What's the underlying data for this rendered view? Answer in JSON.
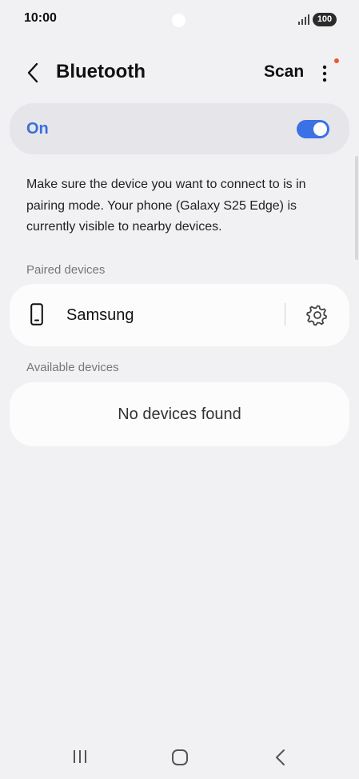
{
  "status_bar": {
    "time": "10:00",
    "battery": "100",
    "signal_icon": "signal-bars-icon"
  },
  "header": {
    "title": "Bluetooth",
    "scan_label": "Scan",
    "back_icon": "chevron-left-icon",
    "more_icon": "more-vertical-icon",
    "notification_dot_color": "#f0562c"
  },
  "toggle": {
    "label": "On",
    "state": true,
    "accent_color": "#3b71e5"
  },
  "info": {
    "text": "Make sure the device you want to connect to is in pairing mode. Your phone (Galaxy S25 Edge) is currently visible to nearby devices."
  },
  "paired": {
    "header": "Paired devices",
    "devices": [
      {
        "name": "Samsung",
        "icon": "phone-icon",
        "settings_icon": "gear-icon"
      }
    ]
  },
  "available": {
    "header": "Available devices",
    "empty_text": "No devices found"
  },
  "nav_bar": {
    "recent_icon": "recent-apps-icon",
    "home_icon": "home-icon",
    "back_icon": "back-icon"
  }
}
